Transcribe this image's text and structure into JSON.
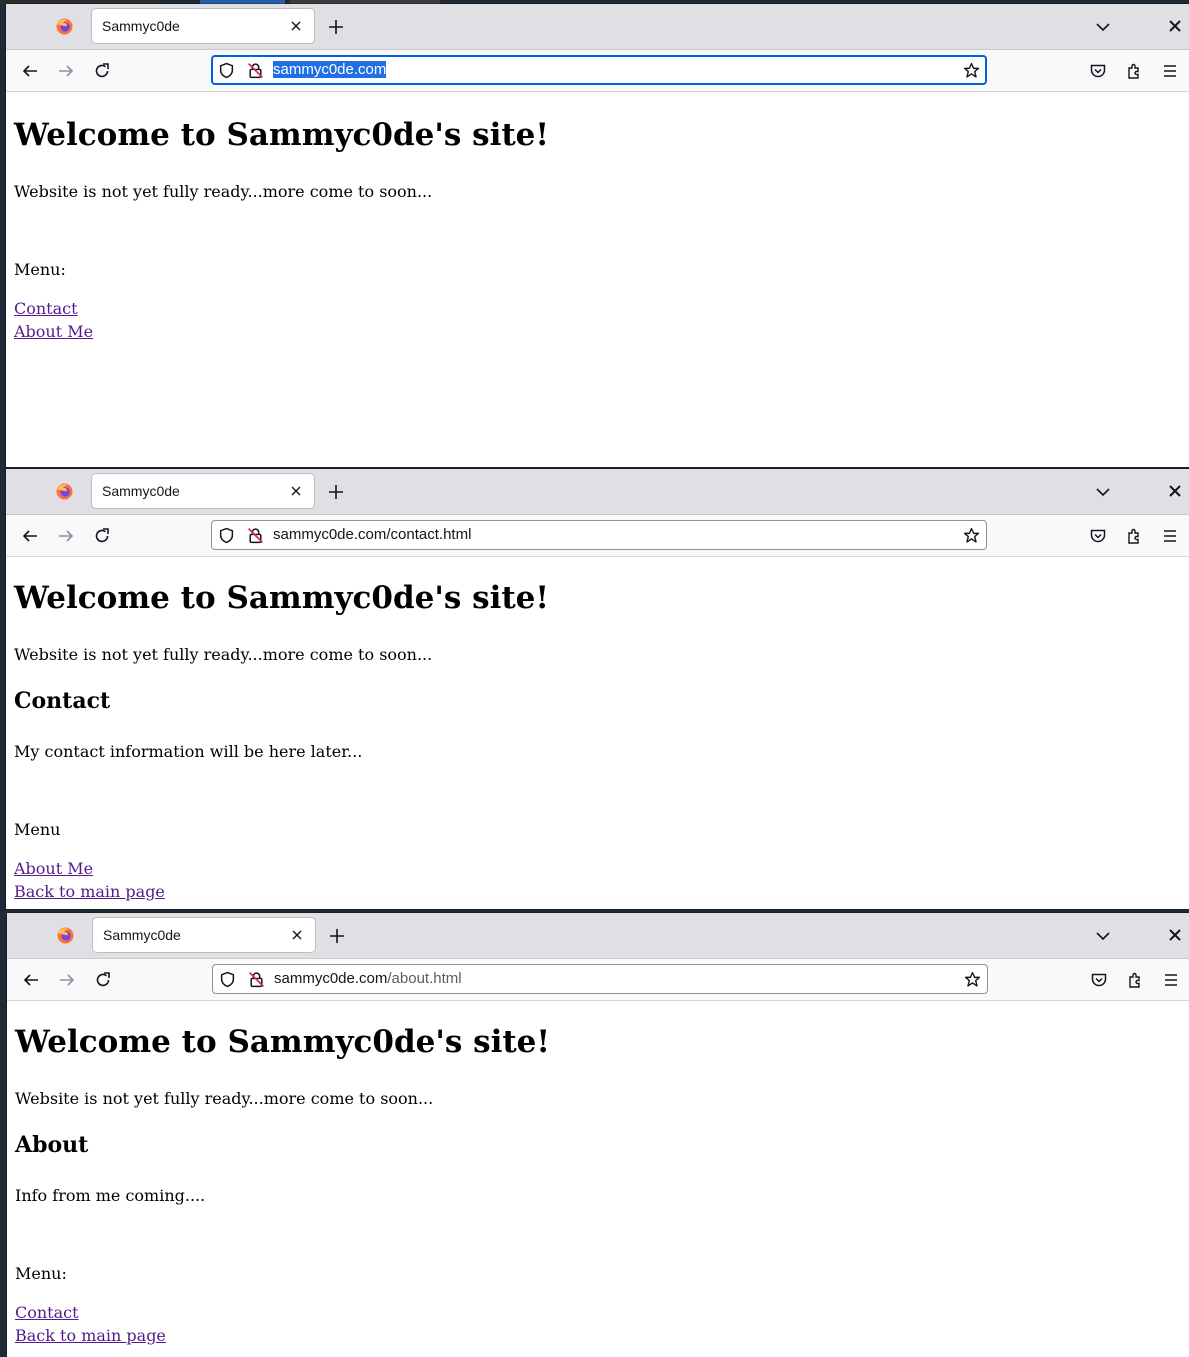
{
  "browser_windows": [
    {
      "tab": {
        "title": "Sammyc0de"
      },
      "url": {
        "host": "sammyc0de.com",
        "path": "",
        "selected": true
      },
      "page": {
        "heading": "Welcome to Sammyc0de's site!",
        "intro": "Website is not yet fully ready...more come to soon...",
        "menu_label": "Menu:",
        "links": [
          "Contact",
          "About Me"
        ]
      }
    },
    {
      "tab": {
        "title": "Sammyc0de"
      },
      "url": {
        "host": "sammyc0de.com",
        "path": "/contact.html",
        "selected": false
      },
      "page": {
        "heading": "Welcome to Sammyc0de's site!",
        "intro": "Website is not yet fully ready...more come to soon...",
        "section_heading": "Contact",
        "section_text": "My contact information will be here later...",
        "menu_label": "Menu",
        "links": [
          "About Me",
          "Back to main page"
        ]
      }
    },
    {
      "tab": {
        "title": "Sammyc0de"
      },
      "url": {
        "host": "sammyc0de.com",
        "path": "/about.html",
        "selected": false
      },
      "page": {
        "heading": "Welcome to Sammyc0de's site!",
        "intro": "Website is not yet fully ready...more come to soon...",
        "section_heading": "About",
        "section_text": "Info from me coming....",
        "menu_label": "Menu:",
        "links": [
          "Contact",
          "Back to main page"
        ]
      }
    }
  ],
  "colors": {
    "link_visited": "#551a8b",
    "url_selection": "#1f6fe5",
    "focus_ring": "#0061e0",
    "tabbar": "#e0dfe3",
    "navbar": "#f9f9fb"
  },
  "icons": [
    "firefox-logo-icon",
    "close-icon",
    "plus-icon",
    "chevron-down-icon",
    "back-arrow-icon",
    "forward-arrow-icon",
    "reload-icon",
    "shield-icon",
    "insecure-lock-icon",
    "star-icon",
    "pocket-icon",
    "extensions-icon",
    "menu-icon"
  ]
}
